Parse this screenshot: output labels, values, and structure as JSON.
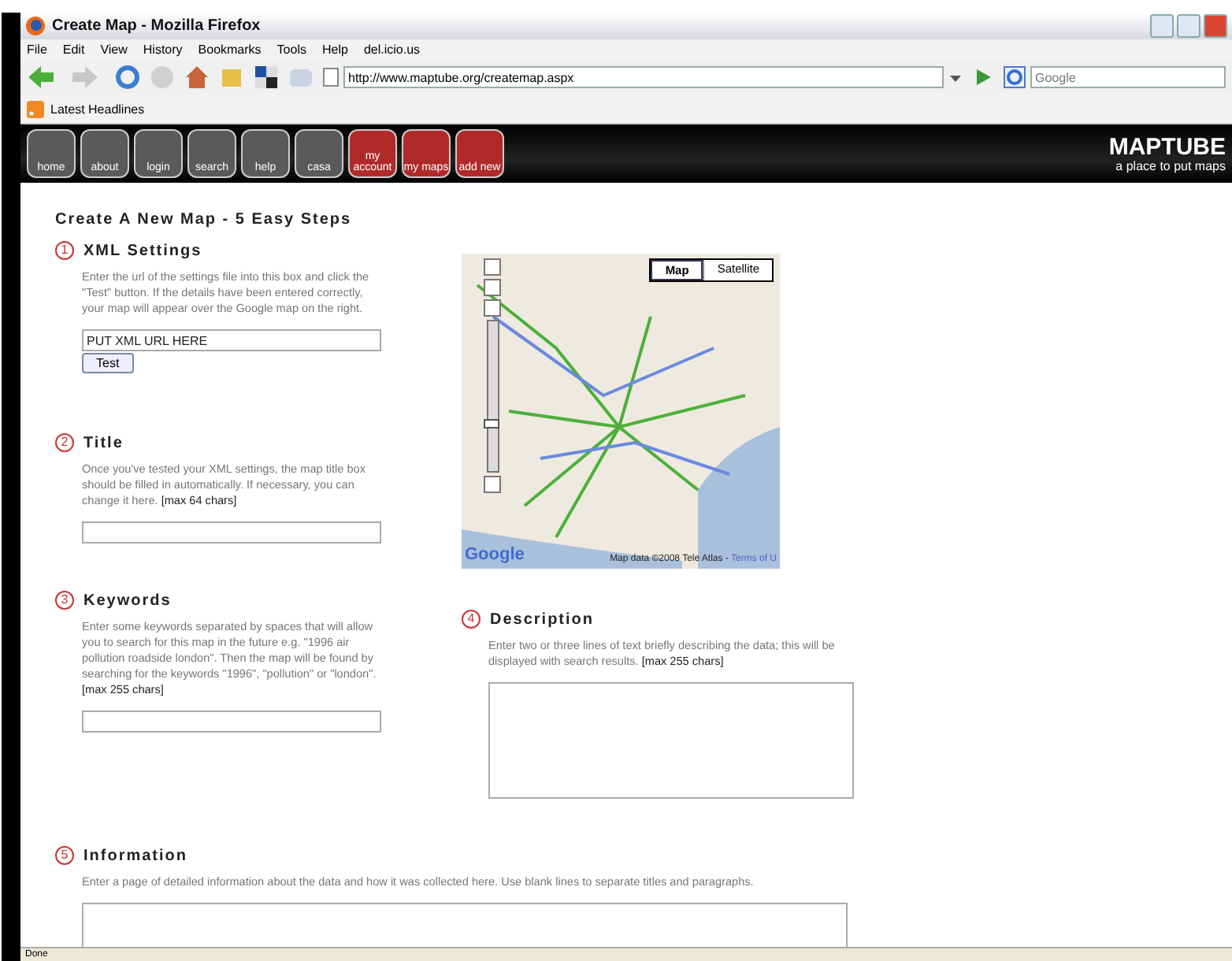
{
  "window": {
    "title": "Create Map - Mozilla Firefox"
  },
  "menu": [
    "File",
    "Edit",
    "View",
    "History",
    "Bookmarks",
    "Tools",
    "Help",
    "del.icio.us"
  ],
  "address": {
    "value": "http://www.maptube.org/createmap.aspx"
  },
  "search": {
    "placeholder": "Google"
  },
  "bookmarks": [
    "Latest Headlines"
  ],
  "nav": [
    {
      "label": "home",
      "color": "#5a5a5a"
    },
    {
      "label": "about",
      "color": "#5a5a5a"
    },
    {
      "label": "login",
      "color": "#5a5a5a"
    },
    {
      "label": "search",
      "color": "#5a5a5a"
    },
    {
      "label": "help",
      "color": "#5a5a5a"
    },
    {
      "label": "casa",
      "color": "#5a5a5a"
    },
    {
      "label": "my account",
      "color": "#b02a2a"
    },
    {
      "label": "my maps",
      "color": "#b02a2a"
    },
    {
      "label": "add new",
      "color": "#b02a2a"
    }
  ],
  "logo": {
    "name": "MAPTUBE",
    "tagline": "a place to put maps"
  },
  "page_title": "Create A New Map - 5 Easy Steps",
  "steps": [
    {
      "number": "1",
      "title": "XML Settings",
      "text": "Enter the url of the settings file into this box and click the \"Test\" button. If the details have been entered correctly, your map will appear over the Google map on the right.",
      "field": {
        "kind": "input",
        "value": "PUT XML URL HERE"
      },
      "button": "Test"
    },
    {
      "number": "2",
      "title": "Title",
      "text": "Once you've tested your XML settings, the map title box should be filled in automatically. If necessary, you can change it here.",
      "limit": "[max 64 chars]",
      "field": {
        "kind": "input"
      }
    },
    {
      "number": "3",
      "title": "Keywords",
      "text": "Enter some keywords separated by spaces that will allow you to search for this map in the future e.g. \"1996 air pollution roadside london\". Then the map will be found by searching for the keywords \"1996\", \"pollution\" or \"london\".",
      "limit": "[max 255 chars]",
      "field": {
        "kind": "input"
      }
    },
    {
      "number": "4",
      "title": "Description",
      "text": "Enter two or three lines of text briefly describing the data; this will be displayed with search results.",
      "limit": "[max 255 chars]",
      "field": {
        "kind": "textarea"
      }
    },
    {
      "number": "5",
      "title": "Information",
      "text": "Enter a page of detailed information about the data and how it was collected here. Use blank lines to separate titles and paragraphs.",
      "field": {
        "kind": "textarea"
      }
    }
  ],
  "map": {
    "zoom": {
      "level": 0.3
    },
    "types": [
      {
        "label": "Map",
        "selected": true
      },
      {
        "label": "Satellite",
        "selected": false
      }
    ],
    "brand": "Google",
    "attribution": "Map data ©2008 Tele Atlas -",
    "terms": "Terms of U"
  },
  "status_bar": {
    "text": "Done"
  }
}
